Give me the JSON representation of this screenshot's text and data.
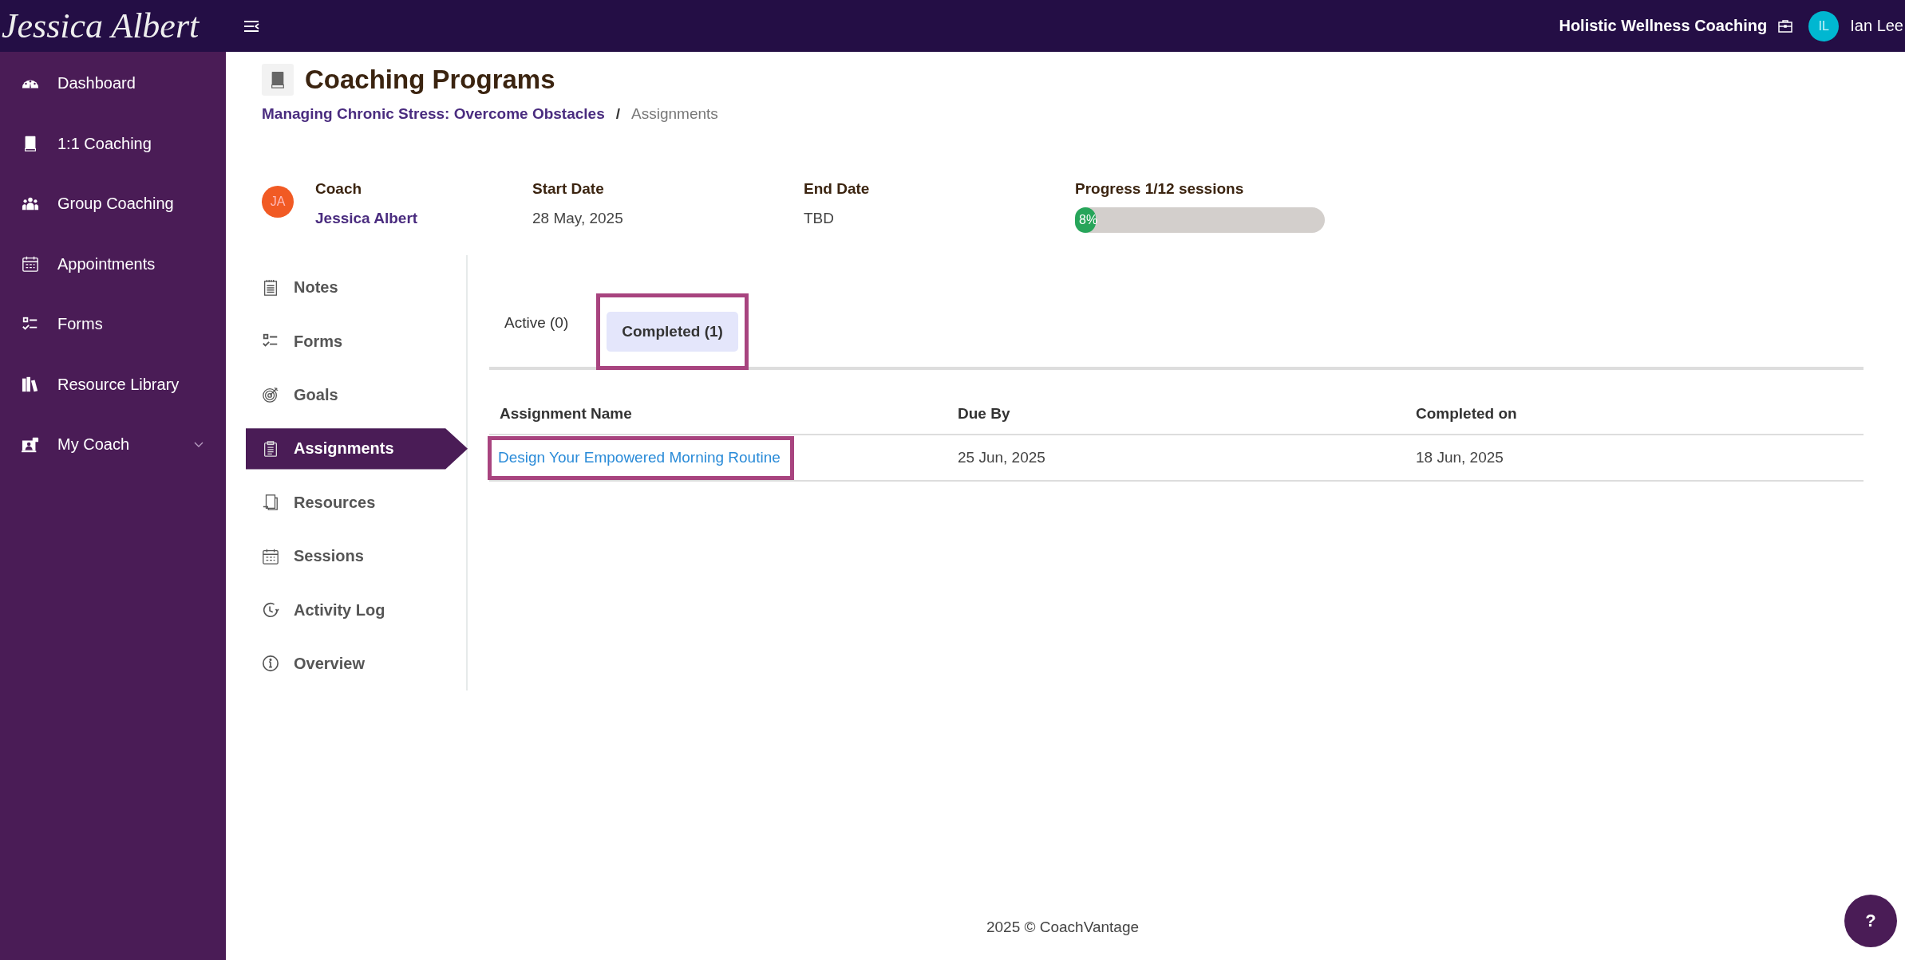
{
  "header": {
    "logo": "Jessica Albert",
    "organization": "Holistic Wellness Coaching",
    "user": {
      "initials": "IL",
      "name": "Ian Lee"
    }
  },
  "sidebar": {
    "items": [
      {
        "label": "Dashboard",
        "expandable": false
      },
      {
        "label": "1:1 Coaching",
        "expandable": false
      },
      {
        "label": "Group Coaching",
        "expandable": false
      },
      {
        "label": "Appointments",
        "expandable": false
      },
      {
        "label": "Forms",
        "expandable": false
      },
      {
        "label": "Resource Library",
        "expandable": false
      },
      {
        "label": "My Coach",
        "expandable": true
      }
    ]
  },
  "page": {
    "title": "Coaching Programs",
    "breadcrumb": [
      {
        "label": "Managing Chronic Stress: Overcome Obstacles",
        "kind": "link"
      },
      {
        "label": "/",
        "kind": "separator"
      },
      {
        "label": "Assignments",
        "kind": "current"
      }
    ],
    "info": {
      "coach": {
        "label": "Coach",
        "initials": "JA",
        "name": "Jessica Albert"
      },
      "start": {
        "label": "Start Date",
        "value": "28 May, 2025"
      },
      "end": {
        "label": "End Date",
        "value": "TBD"
      },
      "progress": {
        "label": "Progress 1/12 sessions",
        "level": 0.083,
        "reading": "8%"
      }
    },
    "subnav": [
      {
        "label": "Notes",
        "selected": false
      },
      {
        "label": "Forms",
        "selected": false
      },
      {
        "label": "Goals",
        "selected": false
      },
      {
        "label": "Assignments",
        "selected": true
      },
      {
        "label": "Resources",
        "selected": false
      },
      {
        "label": "Sessions",
        "selected": false
      },
      {
        "label": "Activity Log",
        "selected": false
      },
      {
        "label": "Overview",
        "selected": false
      }
    ],
    "tabs": [
      {
        "label": "Active (0)",
        "selected": false,
        "highlighted": false
      },
      {
        "label": "Completed (1)",
        "selected": true,
        "highlighted": true
      }
    ],
    "table": {
      "columns": [
        "Assignment Name",
        "Due By",
        "Completed on"
      ],
      "rows": [
        {
          "cells": [
            "Design Your Empowered Morning Routine",
            "25 Jun, 2025",
            "18 Jun, 2025"
          ],
          "highlighted": true
        }
      ]
    }
  },
  "footer": "2025 © CoachVantage",
  "help": "?"
}
